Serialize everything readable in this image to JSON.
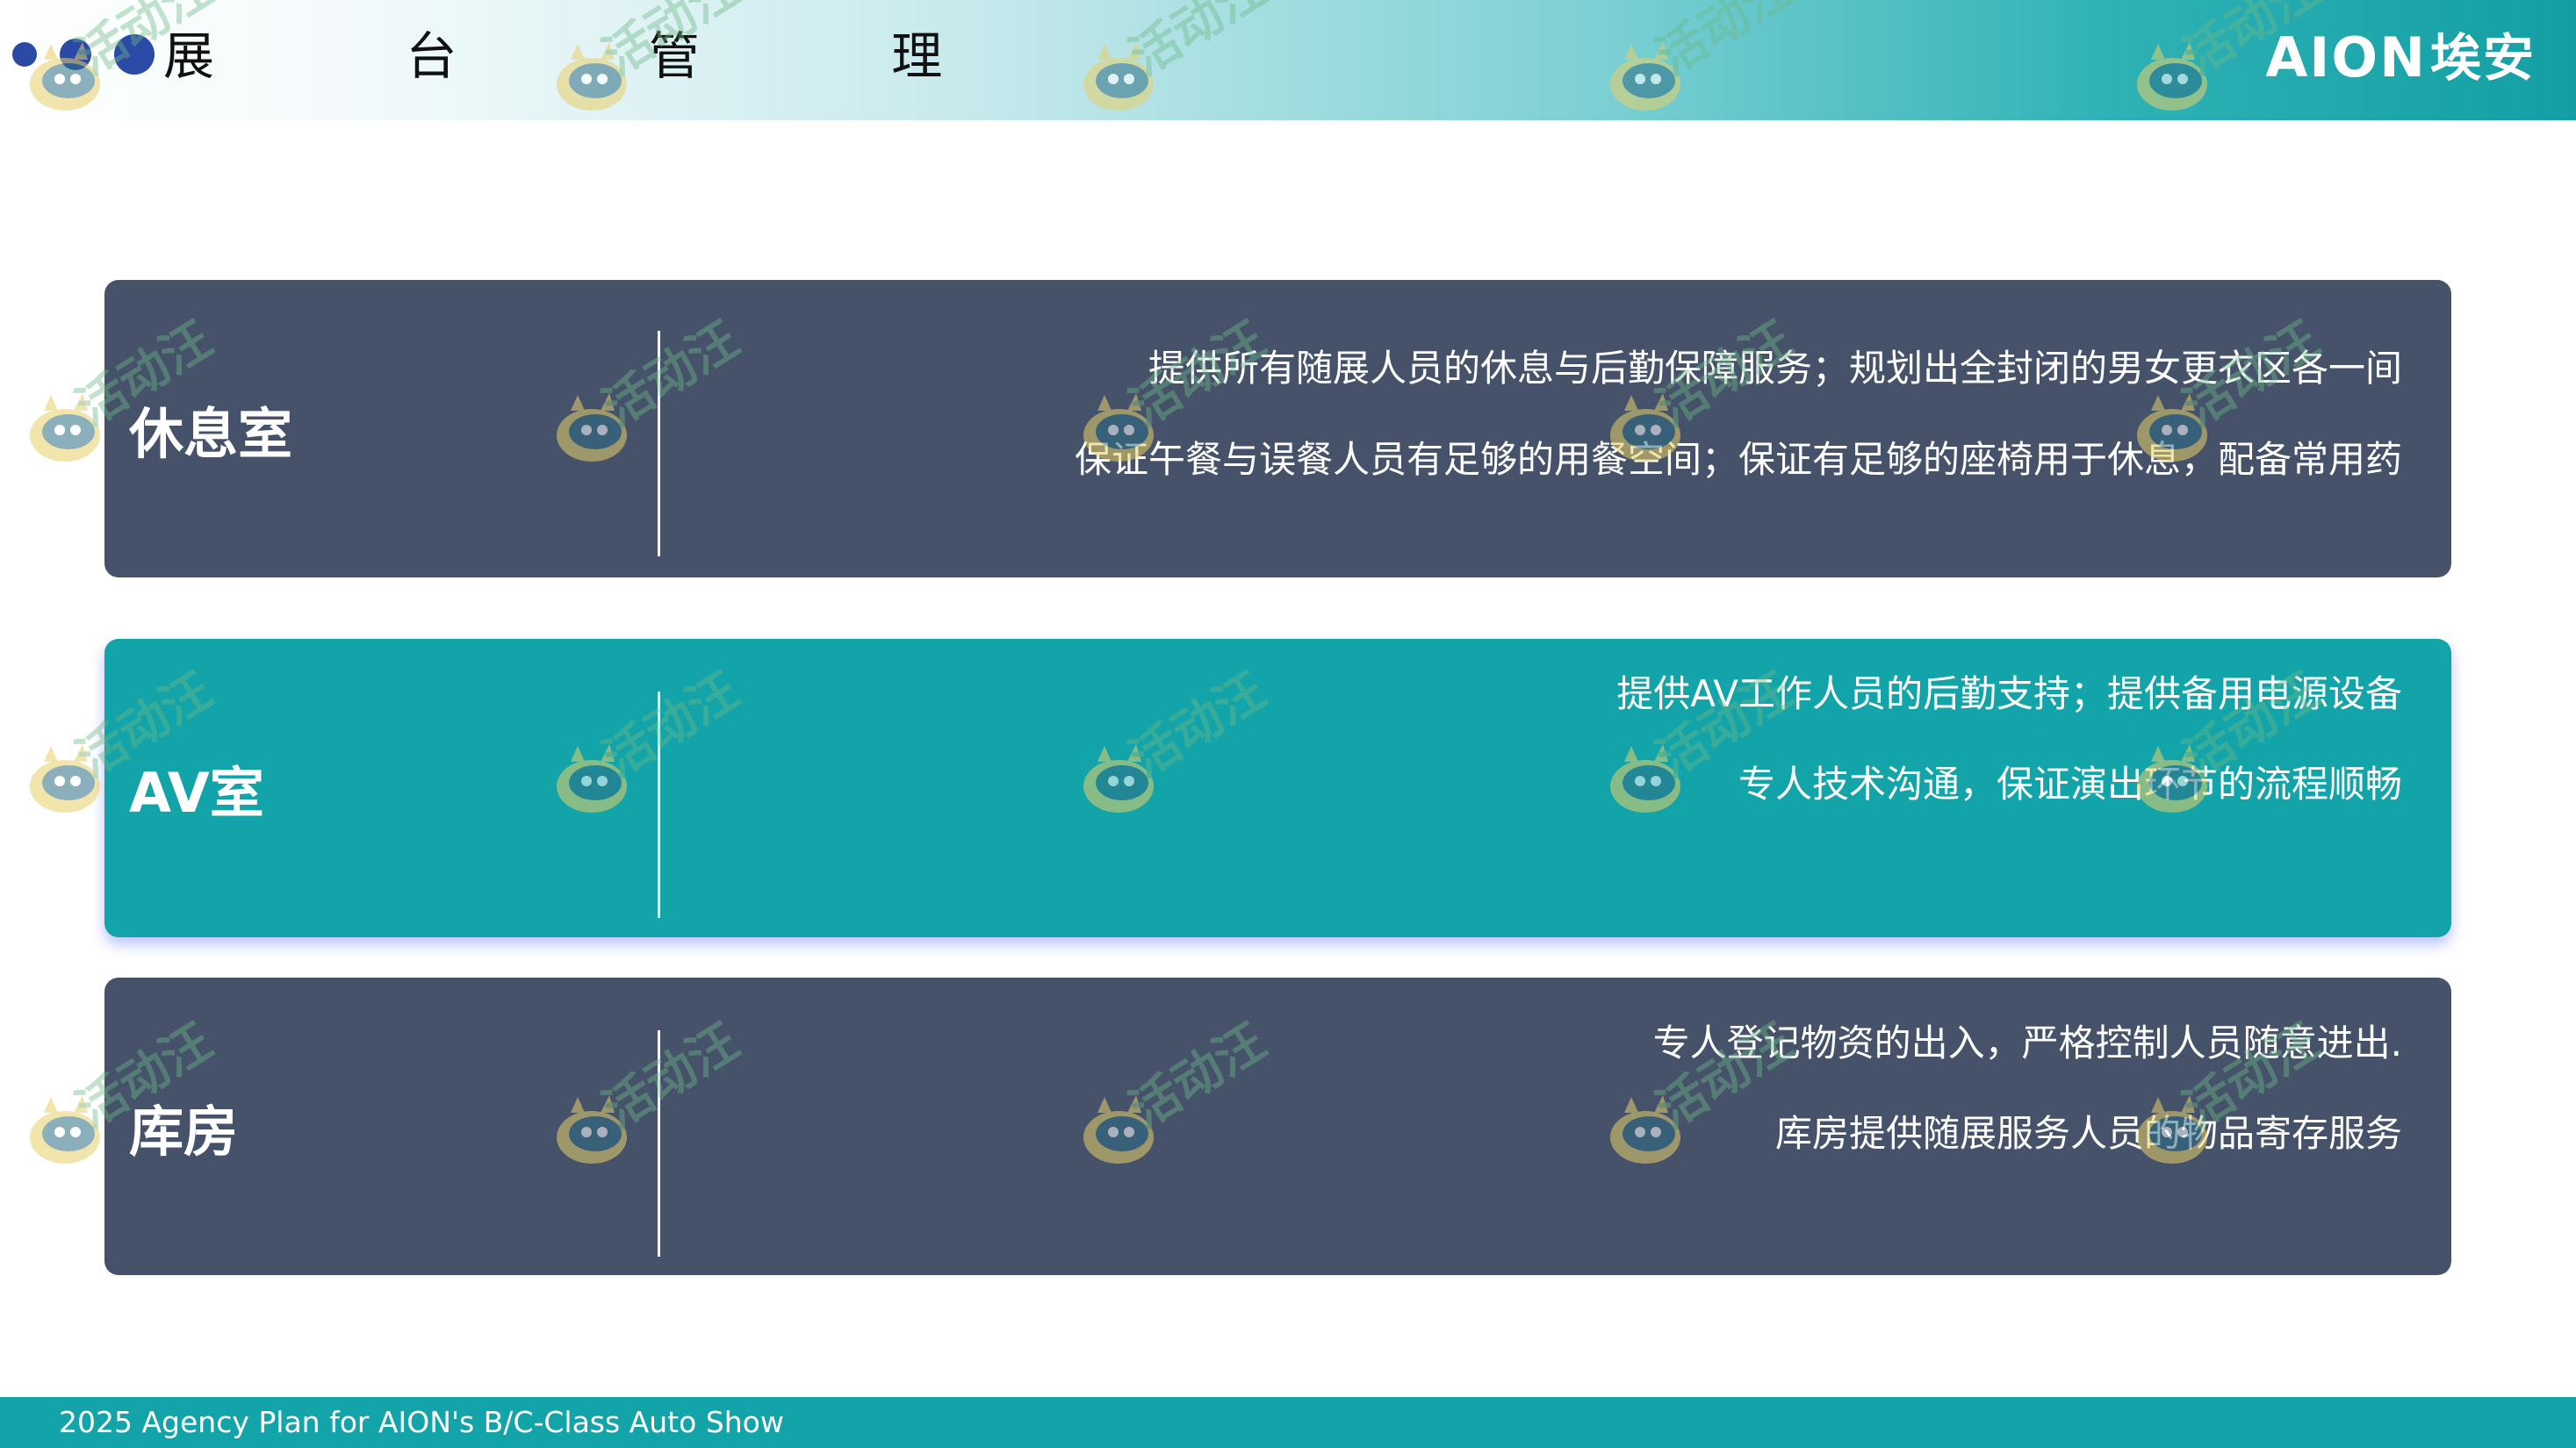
{
  "header": {
    "title": "展 台 管 理",
    "brand_latin": "AION",
    "brand_cn": "埃安"
  },
  "cards": [
    {
      "label": "休息室",
      "lines": [
        "提供所有随展人员的休息与后勤保障服务；规划出全封闭的男女更衣区各一间",
        "保证午餐与误餐人员有足够的用餐空间；保证有足够的座椅用于休息，配备常用药"
      ]
    },
    {
      "label": "AV室",
      "lines": [
        "提供AV工作人员的后勤支持；提供备用电源设备",
        "专人技术沟通，保证演出环节的流程顺畅"
      ]
    },
    {
      "label": "库房",
      "lines": [
        "专人登记物资的出入，严格控制人员随意进出.",
        "库房提供随展服务人员的物品寄存服务"
      ]
    }
  ],
  "footer": {
    "text": "2025 Agency Plan for AION's B/C-Class Auto Show"
  },
  "watermark": {
    "text": "活动汪",
    "icon": "mascot-icon"
  },
  "colors": {
    "navy_card": "#45526a",
    "teal": "#13a4a9",
    "accent_blue": "#2b4aa6"
  }
}
